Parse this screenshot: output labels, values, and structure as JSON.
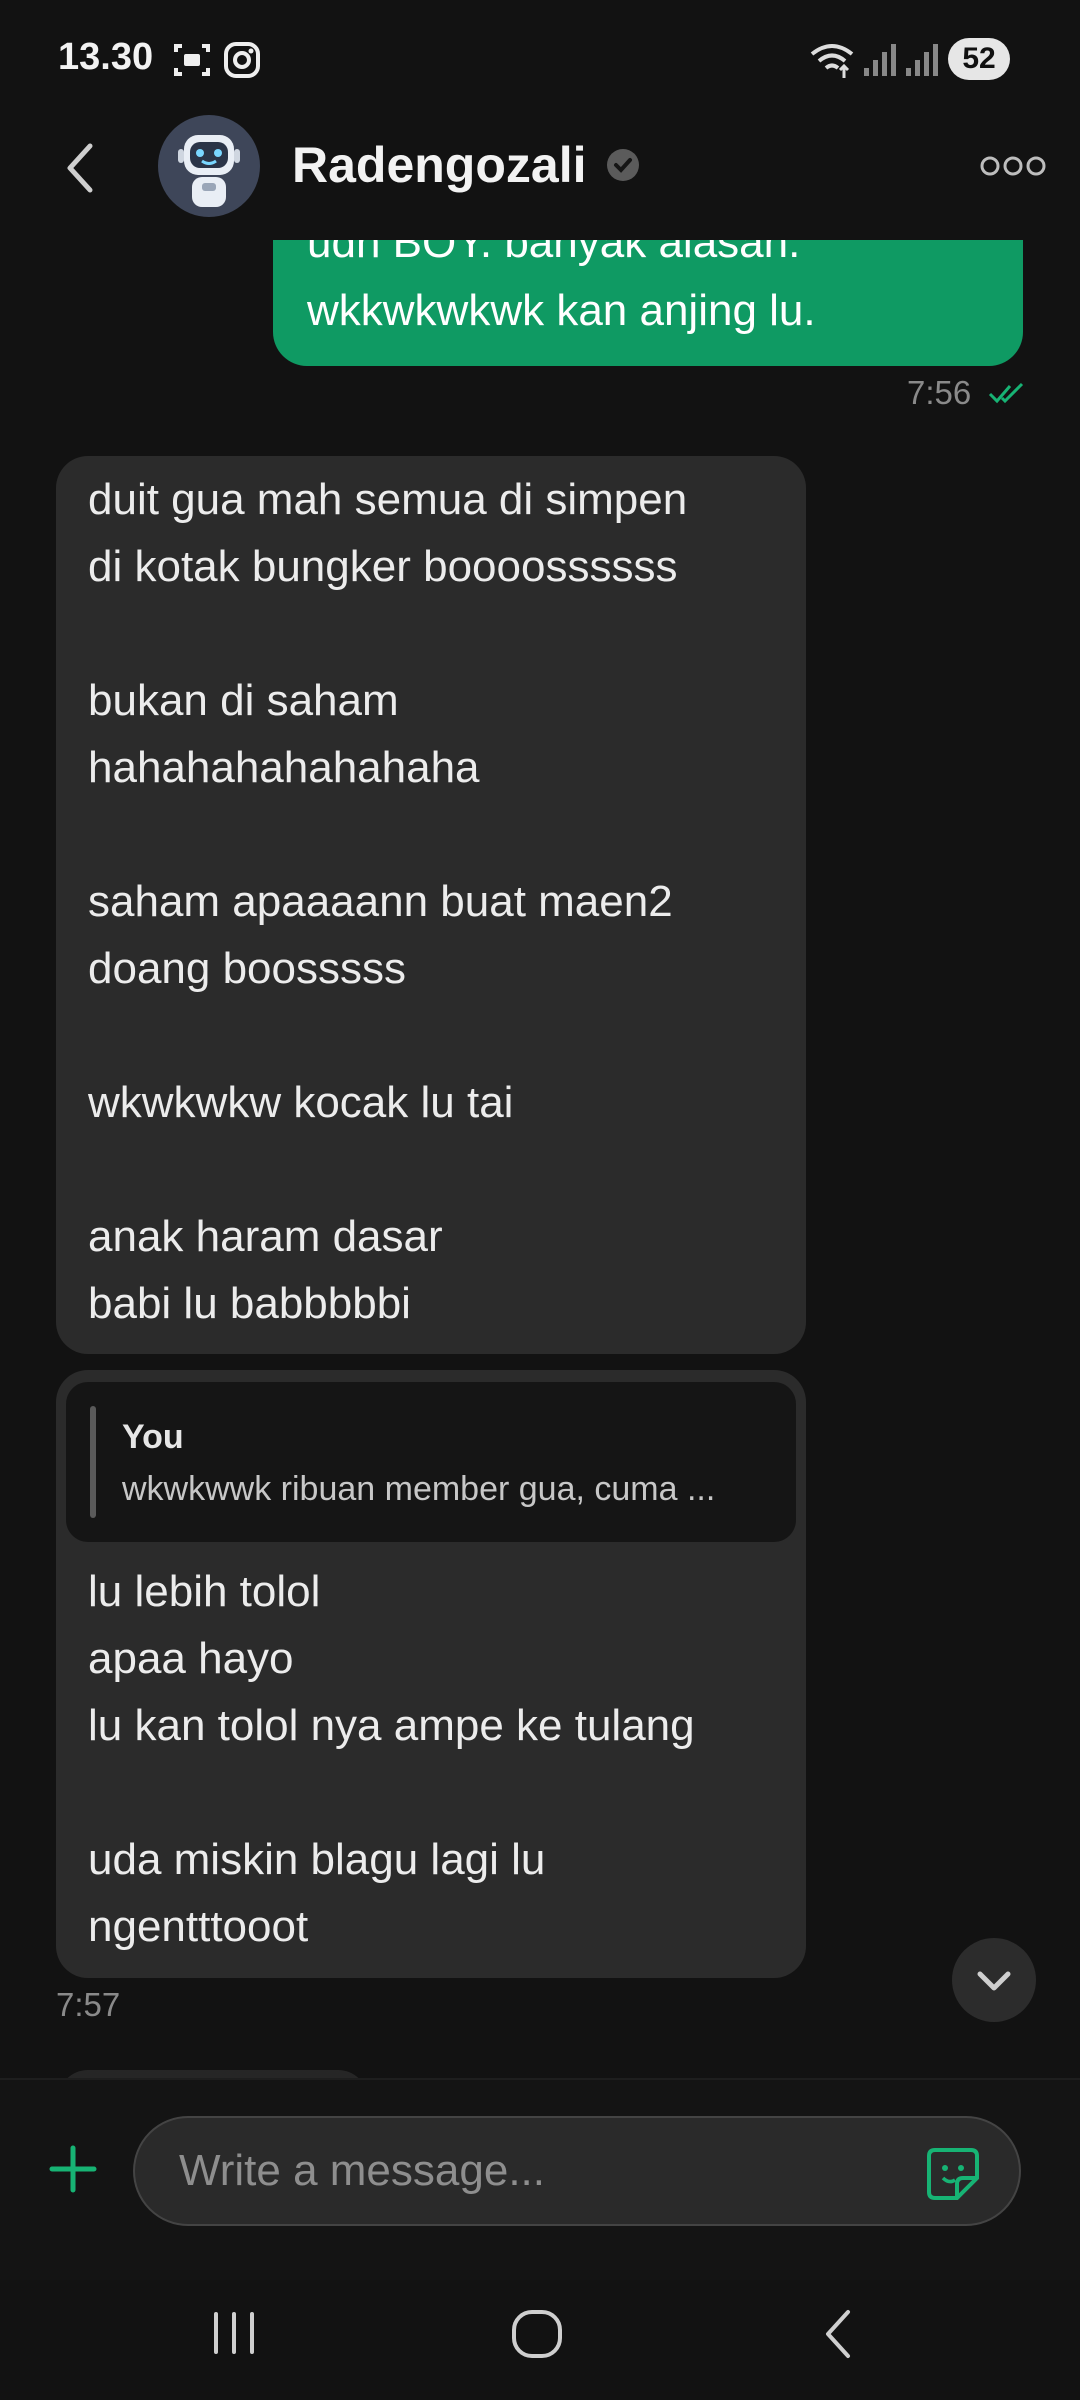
{
  "status_bar": {
    "time": "13.30",
    "battery": "52"
  },
  "header": {
    "contact_name": "Radengozali"
  },
  "messages": {
    "outgoing": {
      "lines": [
        "udh BOY. banyak alasan.",
        "wkkwkwkwk kan anjing lu."
      ],
      "time": "7:56"
    },
    "incoming_1": {
      "lines": [
        "duit gua mah semua di simpen",
        "di kotak bungker boooossssss",
        "",
        "bukan di saham",
        "hahahahahahahaha",
        "",
        "saham apaaaann buat maen2",
        "doang boosssss",
        "",
        "wkwkwkw kocak lu tai",
        "",
        "anak haram dasar",
        "babi lu babbbbbi"
      ]
    },
    "incoming_2": {
      "reply_author": "You",
      "reply_text": "wkwkwwk ribuan member gua, cuma ...",
      "lines": [
        "lu lebih tolol",
        "apaa hayo",
        "lu kan tolol nya ampe ke tulang",
        "",
        "uda miskin blagu lagi lu",
        "ngentttooot"
      ],
      "time": "7:57"
    }
  },
  "composer": {
    "placeholder": "Write a message..."
  },
  "colors": {
    "accent": "#0f9a63",
    "background": "#121212",
    "incoming_bubble": "#2b2b2b"
  },
  "icons": {
    "back": "chevron-left-icon",
    "verified": "verified-badge-icon",
    "more": "more-options-icon",
    "scroll_down": "chevron-down-icon",
    "attach": "plus-icon",
    "sticker": "sticker-icon"
  }
}
